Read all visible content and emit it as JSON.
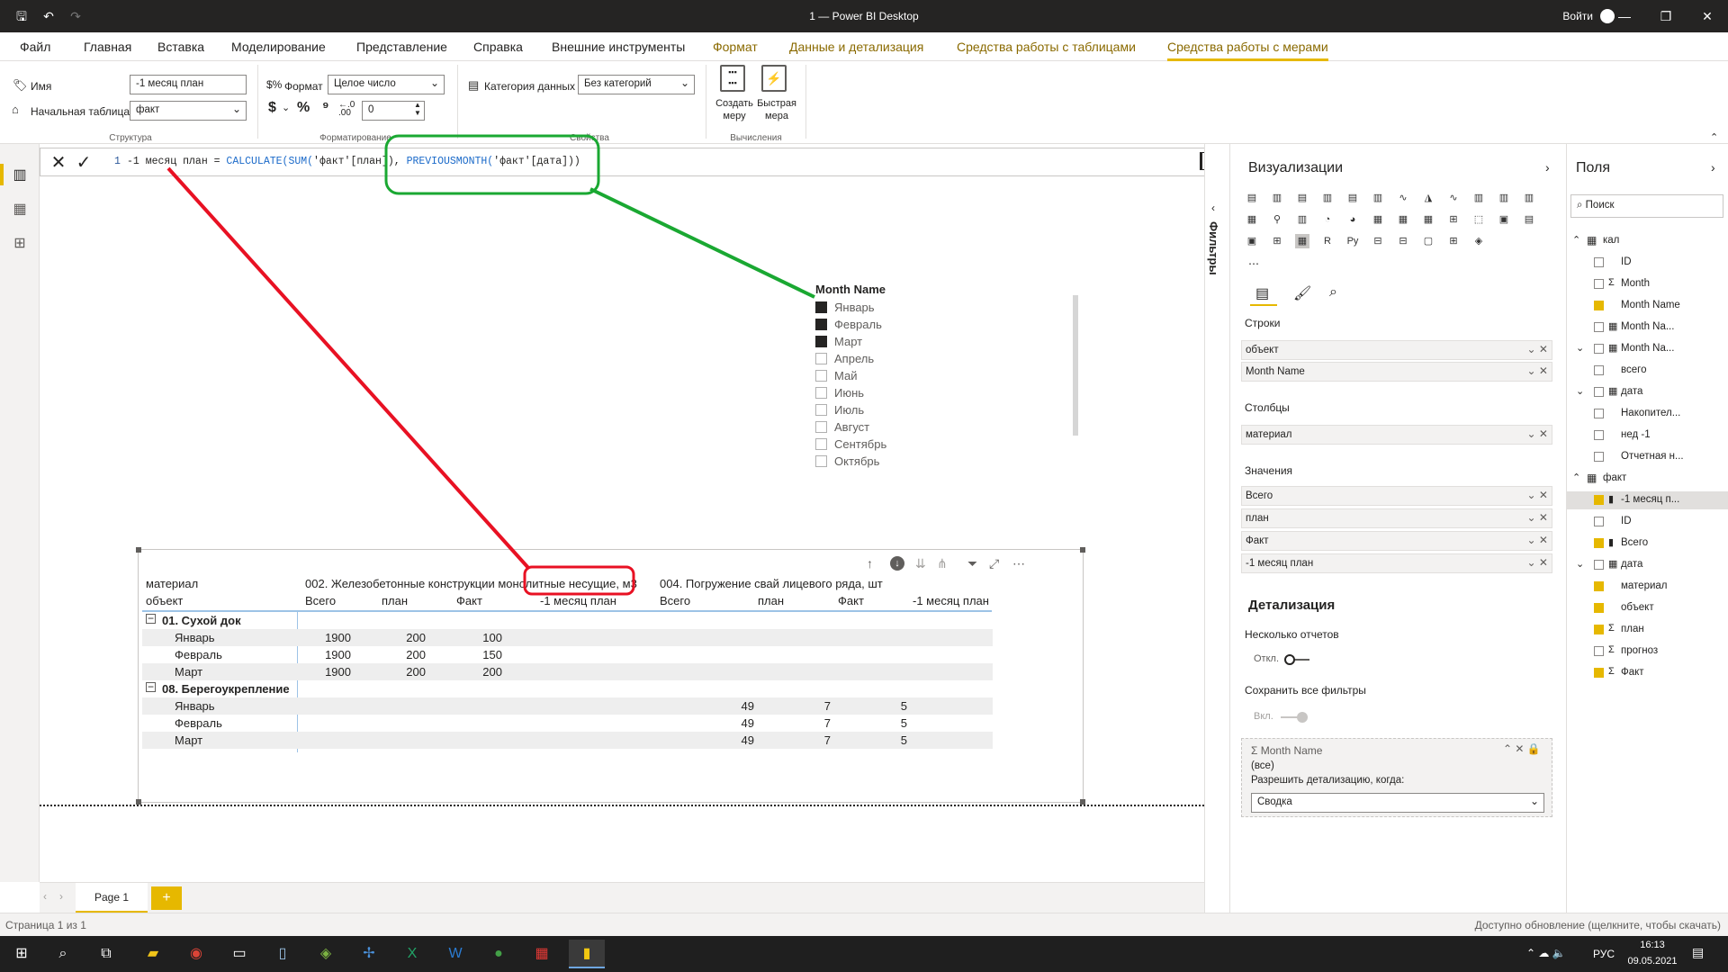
{
  "app": {
    "title": "1 — Power BI Desktop",
    "login": "Войти"
  },
  "tabs": [
    "Файл",
    "Главная",
    "Вставка",
    "Моделирование",
    "Представление",
    "Справка",
    "Внешние инструменты",
    "Формат",
    "Данные и детализация",
    "Средства работы с таблицами",
    "Средства работы с мерами"
  ],
  "ribbon": {
    "name_label": "Имя",
    "name_value": "-1 месяц план",
    "home_table_label": "Начальная таблица",
    "home_table_value": "факт",
    "structure_group": "Структура",
    "format_label": "Формат",
    "format_value": "Целое число",
    "decimals_value": "0",
    "formatting_group": "Форматирование",
    "datacat_label": "Категория данных",
    "datacat_value": "Без категорий",
    "properties_group": "Свойства",
    "new_measure": "Создать меру",
    "quick_measure": "Быстрая мера",
    "calc_group": "Вычисления",
    "currency_symbol": "$",
    "percent_symbol": "%",
    "comma_symbol": "⁹"
  },
  "formula": {
    "line": "1",
    "part1": "-1 месяц план = ",
    "fn1": "CALCULATE(",
    "fn2": "SUM(",
    "part2": "'факт'[план]),",
    "fn3": "PREVIOUSMONTH(",
    "part3": "'факт'[дата]))"
  },
  "slicer": {
    "title": "Month Name",
    "items": [
      {
        "label": "Январь",
        "checked": true
      },
      {
        "label": "Февраль",
        "checked": true
      },
      {
        "label": "Март",
        "checked": true
      },
      {
        "label": "Апрель",
        "checked": false
      },
      {
        "label": "Май",
        "checked": false
      },
      {
        "label": "Июнь",
        "checked": false
      },
      {
        "label": "Июль",
        "checked": false
      },
      {
        "label": "Август",
        "checked": false
      },
      {
        "label": "Сентябрь",
        "checked": false
      },
      {
        "label": "Октябрь",
        "checked": false
      }
    ]
  },
  "matrix": {
    "row_header1": "материал",
    "row_header2": "объект",
    "col_group1": "002. Железобетонные конструкции монолитные несущие, м3",
    "col_group2": "004. Погружение свай лицевого ряда, шт",
    "cols": [
      "Всего",
      "план",
      "Факт",
      "-1 месяц план"
    ],
    "groups": [
      {
        "name": "01. Сухой док",
        "rows": [
          {
            "label": "Январь",
            "v": [
              "1900",
              "200",
              "100",
              "",
              "",
              "",
              "",
              ""
            ]
          },
          {
            "label": "Февраль",
            "v": [
              "1900",
              "200",
              "150",
              "",
              "",
              "",
              "",
              ""
            ]
          },
          {
            "label": "Март",
            "v": [
              "1900",
              "200",
              "200",
              "",
              "",
              "",
              "",
              ""
            ]
          }
        ]
      },
      {
        "name": "08. Берегоукрепление",
        "rows": [
          {
            "label": "Январь",
            "v": [
              "",
              "",
              "",
              "",
              "49",
              "7",
              "5",
              ""
            ]
          },
          {
            "label": "Февраль",
            "v": [
              "",
              "",
              "",
              "",
              "49",
              "7",
              "5",
              ""
            ]
          },
          {
            "label": "Март",
            "v": [
              "",
              "",
              "",
              "",
              "49",
              "7",
              "5",
              ""
            ]
          }
        ]
      }
    ]
  },
  "pages": {
    "tab": "Page 1"
  },
  "status": {
    "left": "Страница 1 из 1",
    "right": "Доступно обновление (щелкните, чтобы скачать)"
  },
  "filters_label": "Фильтры",
  "viz": {
    "title": "Визуализации",
    "rows_label": "Строки",
    "rows": [
      "объект",
      "Month Name"
    ],
    "cols_label": "Столбцы",
    "cols": [
      "материал"
    ],
    "values_label": "Значения",
    "values": [
      "Всего",
      "план",
      "Факт",
      "-1 месяц план"
    ],
    "drill_title": "Детализация",
    "cross_report": "Несколько отчетов",
    "cross_state": "Откл.",
    "keep_filters": "Сохранить все фильтры",
    "keep_state": "Вкл.",
    "drill_field": "Month Name",
    "drill_all": "(все)",
    "drill_when": "Разрешить детализацию, когда:",
    "drill_option": "Сводка",
    "icons": [
      "▤",
      "▥",
      "▤",
      "▥",
      "▤",
      "▥",
      "∿",
      "◮",
      "∿",
      "▥",
      "▥",
      "▥",
      "▦",
      "⚲",
      "▥",
      "◔",
      "◕",
      "▦",
      "▦",
      "▦",
      "⊞",
      "⬚",
      "▣",
      "▤",
      "▣",
      "⊞",
      "▦",
      "R",
      "Py",
      "⊟",
      "⊟",
      "▢",
      "⊞",
      "◈"
    ]
  },
  "fields": {
    "title": "Поля",
    "search": "Поиск",
    "items": [
      {
        "label": "кал",
        "level": 0,
        "type": "table",
        "checked": false,
        "expand": "⌃"
      },
      {
        "label": "ID",
        "level": 1,
        "type": "",
        "checked": false
      },
      {
        "label": "Month",
        "level": 1,
        "type": "Σ",
        "checked": false
      },
      {
        "label": "Month Name",
        "level": 1,
        "type": "",
        "checked": true
      },
      {
        "label": "Month Na...",
        "level": 1,
        "type": "▦",
        "checked": false
      },
      {
        "label": "Month Na...",
        "level": 1,
        "type": "▦",
        "checked": false,
        "expand": "⌄"
      },
      {
        "label": "всего",
        "level": 1,
        "type": "",
        "checked": false
      },
      {
        "label": "дата",
        "level": 1,
        "type": "▦",
        "checked": false,
        "expand": "⌄"
      },
      {
        "label": "Накопител...",
        "level": 1,
        "type": "",
        "checked": false
      },
      {
        "label": "нед -1",
        "level": 1,
        "type": "",
        "checked": false
      },
      {
        "label": "Отчетная н...",
        "level": 1,
        "type": "",
        "checked": false
      },
      {
        "label": "факт",
        "level": 0,
        "type": "table",
        "checked": false,
        "expand": "⌃"
      },
      {
        "label": "-1 месяц п...",
        "level": 1,
        "type": "▮",
        "checked": true,
        "sel": true
      },
      {
        "label": "ID",
        "level": 1,
        "type": "",
        "checked": false
      },
      {
        "label": "Всего",
        "level": 1,
        "type": "▮",
        "checked": true
      },
      {
        "label": "дата",
        "level": 1,
        "type": "▦",
        "checked": false,
        "expand": "⌄"
      },
      {
        "label": "материал",
        "level": 1,
        "type": "",
        "checked": true
      },
      {
        "label": "объект",
        "level": 1,
        "type": "",
        "checked": true
      },
      {
        "label": "план",
        "level": 1,
        "type": "Σ",
        "checked": true
      },
      {
        "label": "прогноз",
        "level": 1,
        "type": "Σ",
        "checked": false
      },
      {
        "label": "Факт",
        "level": 1,
        "type": "Σ",
        "checked": true
      }
    ]
  },
  "taskbar": {
    "lang": "РУС",
    "time": "16:13",
    "date": "09.05.2021"
  },
  "colors": {
    "accent": "#e6b800",
    "annot_red": "#e81123",
    "annot_green": "#1aa832",
    "dax_fn": "#1b6ac9"
  }
}
